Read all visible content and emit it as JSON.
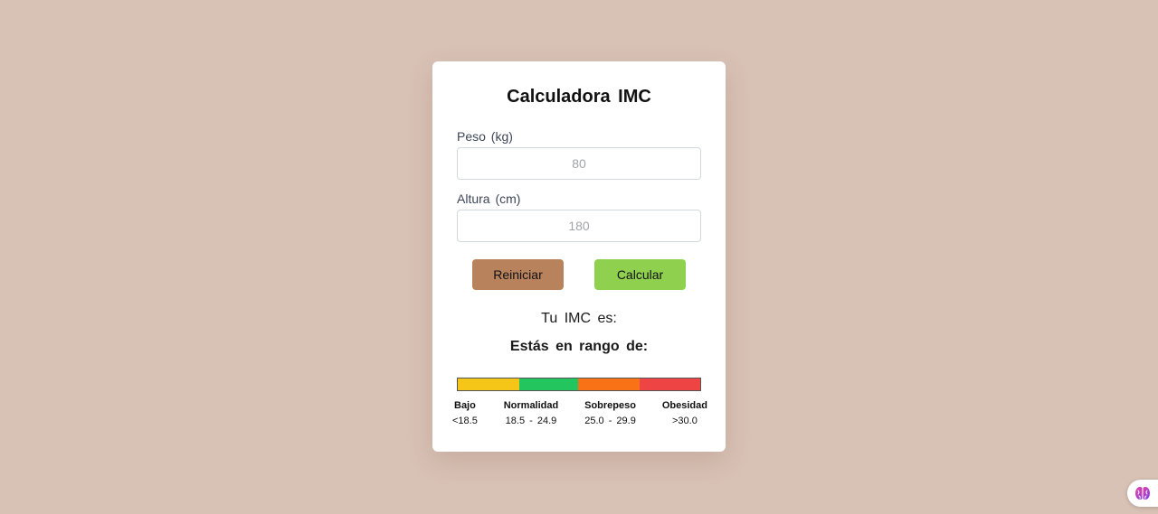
{
  "app": {
    "title": "Calculadora IMC"
  },
  "form": {
    "weight": {
      "label": "Peso (kg)",
      "placeholder": "80",
      "value": ""
    },
    "height": {
      "label": "Altura (cm)",
      "placeholder": "180",
      "value": ""
    }
  },
  "buttons": {
    "reset_label": "Reiniciar",
    "calculate_label": "Calcular"
  },
  "result": {
    "imc_label": "Tu IMC es:",
    "range_label": "Estás en rango de:"
  },
  "scale": {
    "segments": [
      {
        "name": "Bajo",
        "range": "<18.5",
        "color": "#f5c518"
      },
      {
        "name": "Normalidad",
        "range": "18.5 - 24.9",
        "color": "#22c55e"
      },
      {
        "name": "Sobrepeso",
        "range": "25.0 - 29.9",
        "color": "#f97316"
      },
      {
        "name": "Obesidad",
        "range": ">30.0",
        "color": "#ef4444"
      }
    ]
  },
  "colors": {
    "background": "#d8c1b5",
    "card": "#ffffff",
    "reset_button": "#b8825d",
    "calculate_button": "#8fd14f"
  },
  "icons": {
    "helper": "brain-icon"
  }
}
